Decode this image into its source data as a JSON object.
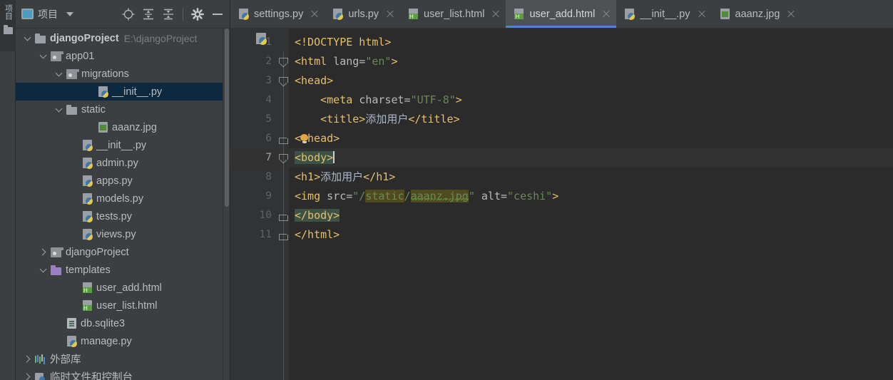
{
  "toolstrip": {
    "vertical_label": "项目",
    "folder_icon": "folder-icon"
  },
  "panel": {
    "title": "项目",
    "project_icon": "project-window-icon",
    "dropdown_icon": "chevron-down-icon",
    "toolbar": [
      {
        "name": "locate-icon",
        "label": "Select Opened File"
      },
      {
        "name": "expand-all-icon",
        "label": "Expand All"
      },
      {
        "name": "collapse-all-icon",
        "label": "Collapse All"
      },
      {
        "name": "settings-gear-icon",
        "label": "Settings"
      },
      {
        "name": "hide-panel-icon",
        "label": "Hide"
      }
    ]
  },
  "tree": [
    {
      "label": "djangoProject",
      "suffix": "E:\\djangoProject",
      "icon": "folder",
      "arrow": "down",
      "indent": 0,
      "bold": true,
      "selected": false
    },
    {
      "label": "app01",
      "suffix": "",
      "icon": "folder-mod",
      "arrow": "down",
      "indent": 1,
      "bold": false,
      "selected": false
    },
    {
      "label": "migrations",
      "suffix": "",
      "icon": "folder-mod",
      "arrow": "down",
      "indent": 2,
      "bold": false,
      "selected": false
    },
    {
      "label": "__init__.py",
      "suffix": "",
      "icon": "py",
      "arrow": "",
      "indent": 4,
      "bold": false,
      "selected": true
    },
    {
      "label": "static",
      "suffix": "",
      "icon": "folder",
      "arrow": "down",
      "indent": 2,
      "bold": false,
      "selected": false
    },
    {
      "label": "aaanz.jpg",
      "suffix": "",
      "icon": "img",
      "arrow": "",
      "indent": 4,
      "bold": false,
      "selected": false
    },
    {
      "label": "__init__.py",
      "suffix": "",
      "icon": "py",
      "arrow": "",
      "indent": 3,
      "bold": false,
      "selected": false
    },
    {
      "label": "admin.py",
      "suffix": "",
      "icon": "py",
      "arrow": "",
      "indent": 3,
      "bold": false,
      "selected": false
    },
    {
      "label": "apps.py",
      "suffix": "",
      "icon": "py",
      "arrow": "",
      "indent": 3,
      "bold": false,
      "selected": false
    },
    {
      "label": "models.py",
      "suffix": "",
      "icon": "py",
      "arrow": "",
      "indent": 3,
      "bold": false,
      "selected": false
    },
    {
      "label": "tests.py",
      "suffix": "",
      "icon": "py",
      "arrow": "",
      "indent": 3,
      "bold": false,
      "selected": false
    },
    {
      "label": "views.py",
      "suffix": "",
      "icon": "py",
      "arrow": "",
      "indent": 3,
      "bold": false,
      "selected": false
    },
    {
      "label": "djangoProject",
      "suffix": "",
      "icon": "folder-mod",
      "arrow": "right",
      "indent": 1,
      "bold": false,
      "selected": false
    },
    {
      "label": "templates",
      "suffix": "",
      "icon": "folder-purple",
      "arrow": "down",
      "indent": 1,
      "bold": false,
      "selected": false
    },
    {
      "label": "user_add.html",
      "suffix": "",
      "icon": "html",
      "arrow": "",
      "indent": 3,
      "bold": false,
      "selected": false
    },
    {
      "label": "user_list.html",
      "suffix": "",
      "icon": "html",
      "arrow": "",
      "indent": 3,
      "bold": false,
      "selected": false
    },
    {
      "label": "db.sqlite3",
      "suffix": "",
      "icon": "db",
      "arrow": "",
      "indent": 2,
      "bold": false,
      "selected": false
    },
    {
      "label": "manage.py",
      "suffix": "",
      "icon": "py",
      "arrow": "",
      "indent": 2,
      "bold": false,
      "selected": false
    },
    {
      "label": "外部库",
      "suffix": "",
      "icon": "lib",
      "arrow": "right",
      "indent": 0,
      "bold": false,
      "selected": false
    },
    {
      "label": "临时文件和控制台",
      "suffix": "",
      "icon": "scratch",
      "arrow": "right",
      "indent": 0,
      "bold": false,
      "selected": false
    }
  ],
  "tabs": [
    {
      "label": "settings.py",
      "icon": "python-file-icon",
      "active": false
    },
    {
      "label": "urls.py",
      "icon": "python-file-icon",
      "active": false
    },
    {
      "label": "user_list.html",
      "icon": "html-file-icon",
      "active": false
    },
    {
      "label": "user_add.html",
      "icon": "html-file-icon",
      "active": true
    },
    {
      "label": "__init__.py",
      "icon": "python-file-icon",
      "active": false
    },
    {
      "label": "aaanz.jpg",
      "icon": "image-file-icon",
      "active": false
    }
  ],
  "editor": {
    "line_numbers": [
      "1",
      "2",
      "3",
      "4",
      "5",
      "6",
      "7",
      "8",
      "9",
      "10",
      "11"
    ],
    "current_line": 7,
    "lines": [
      {
        "n": "1",
        "text": "<!DOCTYPE html>"
      },
      {
        "n": "2",
        "text": "<html lang=\"en\">"
      },
      {
        "n": "3",
        "text": "<head>"
      },
      {
        "n": "4",
        "text": "    <meta charset=\"UTF-8\">"
      },
      {
        "n": "5",
        "text": "    <title>添加用户</title>"
      },
      {
        "n": "6",
        "text": "</head>"
      },
      {
        "n": "7",
        "text": "<body>"
      },
      {
        "n": "8",
        "text": "<h1>添加用户</h1>"
      },
      {
        "n": "9",
        "text": "<img src=\"/static/aaanz.jpg\" alt=\"ceshi\">"
      },
      {
        "n": "10",
        "text": "</body>"
      },
      {
        "n": "11",
        "text": "</html>"
      }
    ],
    "tokens": {
      "l1_tag": "<!DOCTYPE html>",
      "l2_a": "<html ",
      "l2_b": "lang=",
      "l2_c": "\"en\"",
      "l2_d": ">",
      "l3": "<head>",
      "l4_a": "    <meta ",
      "l4_b": "charset=",
      "l4_c": "\"UTF-8\"",
      "l4_d": ">",
      "l5_a": "    <title>",
      "l5_b": "添加用户",
      "l5_c": "</title>",
      "l6_a": "<",
      "l6_b": "head>",
      "l7": "<body>",
      "l8_a": "<h1>",
      "l8_b": "添加用户",
      "l8_c": "</h1>",
      "l9_a": "<img ",
      "l9_b": "src=",
      "l9_c": "\"/",
      "l9_d": "static",
      "l9_e": "/",
      "l9_f": "aaanz.jpg",
      "l9_g": "\" ",
      "l9_h": "alt=",
      "l9_i": "\"ceshi\"",
      "l9_j": ">",
      "l10": "</body>",
      "l11": "</html>"
    },
    "colors": {
      "background": "#2b2b2b",
      "gutter": "#313335",
      "tag": "#e8bf6a",
      "string": "#6a8759",
      "attribute": "#bababa",
      "text": "#a9b7c6",
      "current_line": "#323232",
      "match_highlight": "#3b5245",
      "search_highlight": "#4f4b1e",
      "selection": "#0d293f",
      "tab_accent": "#4a88c7"
    }
  }
}
